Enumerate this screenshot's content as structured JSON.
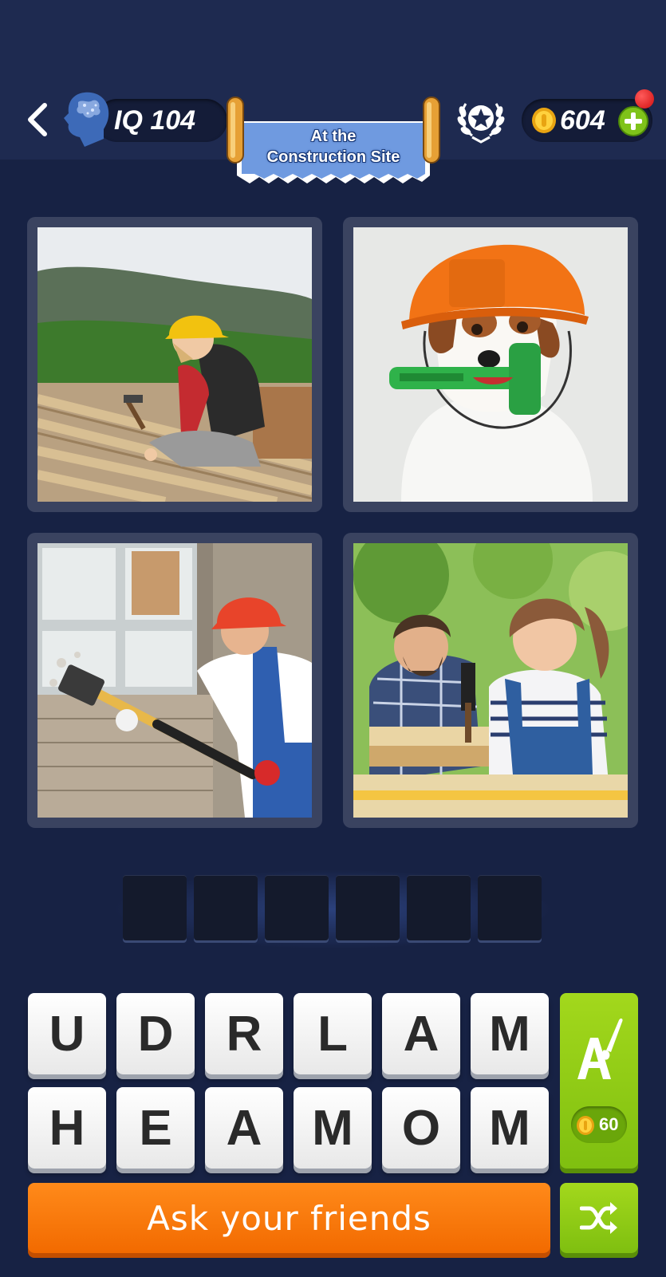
{
  "header": {
    "iq_label": "IQ 104",
    "level_title_line1": "At the",
    "level_title_line2": "Construction Site",
    "coins": "604"
  },
  "puzzle": {
    "photos": [
      {
        "name": "photo-worker-on-roof",
        "icon": "woman-hammering-roof-beams"
      },
      {
        "name": "photo-dog-with-hammer",
        "icon": "dog-in-hard-hat-with-toy-hammer"
      },
      {
        "name": "photo-demolition-worker",
        "icon": "man-swinging-sledgehammer"
      },
      {
        "name": "photo-father-daughter",
        "icon": "girl-hammering-birdhouse"
      }
    ],
    "answer_slots": [
      "",
      "",
      "",
      "",
      "",
      ""
    ],
    "letters_row1": [
      "U",
      "D",
      "R",
      "L",
      "A",
      "M"
    ],
    "letters_row2": [
      "H",
      "E",
      "A",
      "M",
      "O",
      "M"
    ]
  },
  "actions": {
    "hint_cost": "60",
    "ask_friends_label": "Ask your friends"
  },
  "colors": {
    "background": "#172244",
    "ask_button": "#f26a00",
    "hint_button": "#8cc814",
    "notification": "#e01818"
  }
}
